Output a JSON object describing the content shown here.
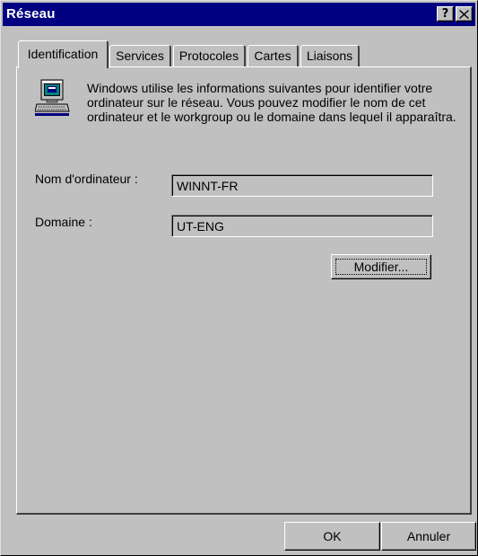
{
  "window": {
    "title": "Réseau",
    "help_button": "?",
    "close_button": "✕"
  },
  "tabs": [
    {
      "label": "Identification",
      "active": true
    },
    {
      "label": "Services",
      "active": false
    },
    {
      "label": "Protocoles",
      "active": false
    },
    {
      "label": "Cartes",
      "active": false
    },
    {
      "label": "Liaisons",
      "active": false
    }
  ],
  "identification": {
    "icon": "network-computer-icon",
    "description": "Windows utilise les informations suivantes pour identifier votre ordinateur sur le réseau. Vous pouvez modifier le nom de cet ordinateur et le workgroup ou le domaine dans lequel il apparaîtra.",
    "computer_name_label": "Nom d'ordinateur :",
    "computer_name_value": "WINNT-FR",
    "domain_label": "Domaine :",
    "domain_value": "UT-ENG",
    "modify_button": "Modifier..."
  },
  "footer": {
    "ok_button": "OK",
    "cancel_button": "Annuler"
  }
}
